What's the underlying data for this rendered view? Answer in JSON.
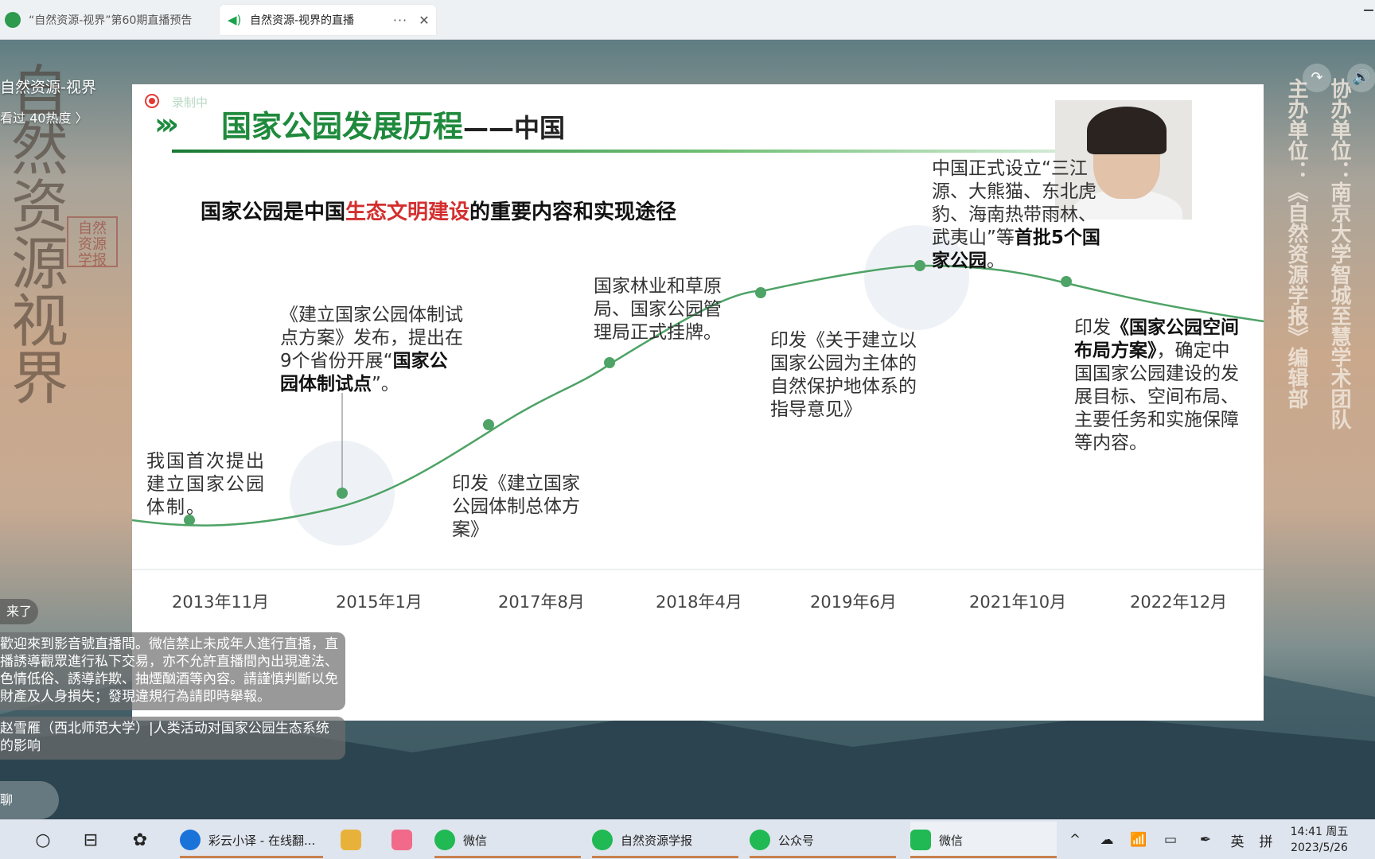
{
  "browser": {
    "tabs": [
      {
        "title": "“自然资源-视界”第60期直播预告",
        "active": false
      },
      {
        "title": "自然资源-视界的直播",
        "active": true
      }
    ],
    "more_label": "···",
    "close_label": "✕"
  },
  "stream": {
    "room_title": "自然资源-视界",
    "room_stats": "看过 40热度 〉",
    "host_label": "主办单位：《自然资源学报》编辑部",
    "coop_label": "协办单位：南京大学智城至慧学术团队",
    "share_icon": "↷",
    "volume_icon": "🔊",
    "seal_big": [
      "自",
      "然",
      "资",
      "源",
      "视",
      "界"
    ],
    "seal_small": "自然资源学报"
  },
  "slide": {
    "rec_label": "录制中",
    "chevrons": "›››",
    "title_main": "国家公园发展历程",
    "title_sub": "——中国",
    "subtitle_pre": "国家公园是中国",
    "subtitle_red": "生态文明建设",
    "subtitle_post": "的重要内容和实现途径",
    "events": [
      {
        "text": "我国首次提出建立国家公园体制。",
        "bold": ""
      },
      {
        "text": "《建立国家公园体制试点方案》发布，提出在9个省份开展“",
        "bold": "国家公园体制试点",
        "tail": "”。"
      },
      {
        "text": "印发《建立国家公园体制总体方案》",
        "bold": ""
      },
      {
        "text": "国家林业和草原局、国家公园管理局正式挂牌。",
        "bold": ""
      },
      {
        "text": "印发《关于建立以国家公园为主体的自然保护地体系的指导意见》",
        "bold": ""
      },
      {
        "text": "中国正式设立“三江源、大熊猫、东北虎豹、海南热带雨林、武夷山”等",
        "bold": "首批5个国家公园",
        "tail": "。"
      },
      {
        "text": "印发",
        "bold": "《国家公园空间布局方案》",
        "tail": "，确定中国国家公园建设的发展目标、空间布局、主要任务和实施保障等内容。"
      }
    ],
    "dates": [
      "2013年11月",
      "2015年1月",
      "2017年8月",
      "2018年4月",
      "2019年6月",
      "2021年10月",
      "2022年12月"
    ],
    "colors": {
      "accent": "#1f8a3c",
      "highlight": "#d32f2f",
      "line": "#4ea366"
    }
  },
  "chat": {
    "pill": "来了",
    "notice": "歡迎來到影音號直播間。微信禁止未成年人進行直播，直播誘導觀眾進行私下交易，亦不允許直播間內出現違法、色情低俗、誘導詐欺、抽煙酗酒等內容。請謹慎判斷以免財產及人身損失；發現違規行為請即時舉報。",
    "message": "赵雪雁（西北师范大学）|人类活动对国家公园生态系统的影响",
    "input_placeholder": "聊"
  },
  "taskbar": {
    "search_icon": "○",
    "taskview_icon": "⊟",
    "apps": [
      {
        "label": "彩云小译 - 在线翻...",
        "color": "#1a73d9"
      },
      {
        "label": "",
        "color": "#e8b23a"
      },
      {
        "label": "",
        "color": "#f16a8a"
      },
      {
        "label": "微信",
        "color": "#20b954"
      },
      {
        "label": "自然资源学报",
        "color": "#20b954"
      },
      {
        "label": "公众号",
        "color": "#20b954"
      },
      {
        "label": "微信",
        "color": "#20b954"
      }
    ],
    "tray": [
      "^",
      "☁",
      "📶",
      "▭",
      "✒",
      "英",
      "拼"
    ],
    "time": "14:41 周五",
    "date": "2023/5/26"
  }
}
